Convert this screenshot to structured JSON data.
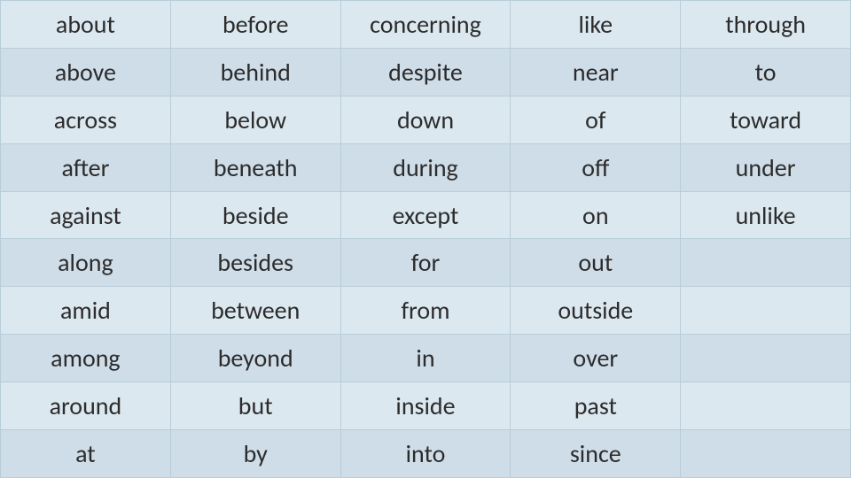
{
  "columns": [
    {
      "id": "col1",
      "words": [
        "about",
        "above",
        "across",
        "after",
        "against",
        "along",
        "amid",
        "among",
        "around",
        "at"
      ]
    },
    {
      "id": "col2",
      "words": [
        "before",
        "behind",
        "below",
        "beneath",
        "beside",
        "besides",
        "between",
        "beyond",
        "but",
        "by"
      ]
    },
    {
      "id": "col3",
      "words": [
        "concerning",
        "despite",
        "down",
        "during",
        "except",
        "for",
        "from",
        "in",
        "inside",
        "into"
      ]
    },
    {
      "id": "col4",
      "words": [
        "like",
        "near",
        "of",
        "off",
        "on",
        "out",
        "outside",
        "over",
        "past",
        "since"
      ]
    },
    {
      "id": "col5",
      "words": [
        "through",
        "to",
        "toward",
        "under",
        "unlike",
        "",
        "",
        "",
        "",
        ""
      ]
    }
  ],
  "num_rows": 10
}
